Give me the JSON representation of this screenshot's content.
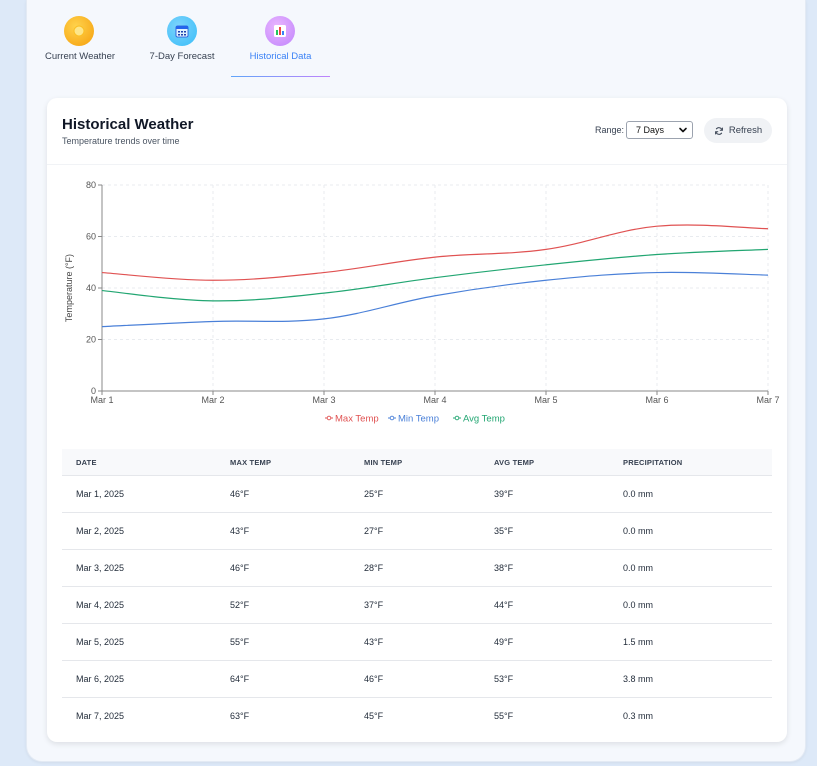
{
  "tabs": [
    {
      "label": "Current Weather",
      "icon": "sun-icon"
    },
    {
      "label": "7-Day Forecast",
      "icon": "calendar-icon"
    },
    {
      "label": "Historical Data",
      "icon": "bar-chart-icon",
      "active": true
    }
  ],
  "card": {
    "title": "Historical Weather",
    "subtitle": "Temperature trends over time",
    "range_label": "Range:",
    "range_value": "7 Days",
    "refresh_label": "Refresh"
  },
  "chart_data": {
    "type": "line",
    "x": [
      "Mar 1",
      "Mar 2",
      "Mar 3",
      "Mar 4",
      "Mar 5",
      "Mar 6",
      "Mar 7"
    ],
    "ylabel": "Temperature (°F)",
    "ylim": [
      0,
      80
    ],
    "yticks": [
      0,
      20,
      40,
      60,
      80
    ],
    "grid": true,
    "legend": "bottom",
    "series": [
      {
        "name": "Max Temp",
        "color": "#e05252",
        "values": [
          46,
          43,
          46,
          52,
          55,
          64,
          63
        ]
      },
      {
        "name": "Min Temp",
        "color": "#4a80d8",
        "values": [
          25,
          27,
          28,
          37,
          43,
          46,
          45
        ]
      },
      {
        "name": "Avg Temp",
        "color": "#22a672",
        "values": [
          39,
          35,
          38,
          44,
          49,
          53,
          55
        ]
      }
    ]
  },
  "table": {
    "headers": [
      "DATE",
      "MAX TEMP",
      "MIN TEMP",
      "AVG TEMP",
      "PRECIPITATION"
    ],
    "rows": [
      [
        "Mar 1, 2025",
        "46°F",
        "25°F",
        "39°F",
        "0.0 mm"
      ],
      [
        "Mar 2, 2025",
        "43°F",
        "27°F",
        "35°F",
        "0.0 mm"
      ],
      [
        "Mar 3, 2025",
        "46°F",
        "28°F",
        "38°F",
        "0.0 mm"
      ],
      [
        "Mar 4, 2025",
        "52°F",
        "37°F",
        "44°F",
        "0.0 mm"
      ],
      [
        "Mar 5, 2025",
        "55°F",
        "43°F",
        "49°F",
        "1.5 mm"
      ],
      [
        "Mar 6, 2025",
        "64°F",
        "46°F",
        "53°F",
        "3.8 mm"
      ],
      [
        "Mar 7, 2025",
        "63°F",
        "45°F",
        "55°F",
        "0.3 mm"
      ]
    ]
  }
}
